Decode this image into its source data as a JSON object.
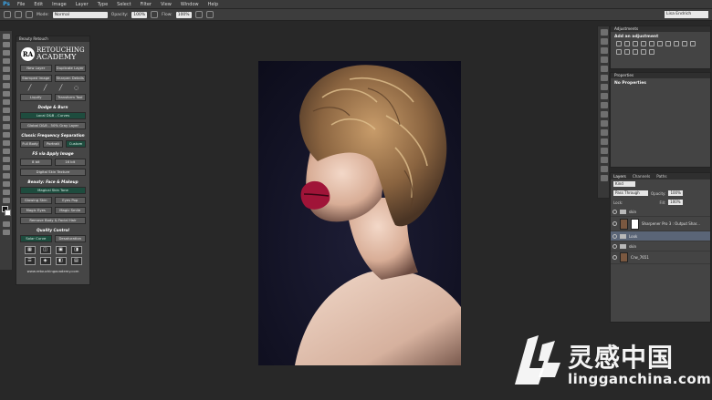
{
  "app": {
    "logo": "Ps"
  },
  "menu": [
    "File",
    "Edit",
    "Image",
    "Layer",
    "Type",
    "Select",
    "Filter",
    "View",
    "Window",
    "Help"
  ],
  "options_bar": {
    "mode_label": "Mode:",
    "mode_value": "Normal",
    "opacity_label": "Opacity:",
    "opacity_value": "100%",
    "flow_label": "Flow:",
    "flow_value": "100%",
    "workspace": "Lisa Endrich"
  },
  "beauty_panel": {
    "title": "Beauty Retouch",
    "logo_badge": "RA",
    "logo_line1": "RETOUCHING",
    "logo_line2": "ACADEMY",
    "row1": [
      "New Layer",
      "Duplicate Layer"
    ],
    "row2": [
      "Stamped Image",
      "Sharpen Details"
    ],
    "row3": [
      "Liquify",
      "Transform Tool"
    ],
    "sec_dodge": "Dodge & Burn",
    "btn_local_dnb": "Local D&B - Curves",
    "btn_global_dnb": "Global D&B - 50% Gray Layer",
    "sec_freq": "Classic Frequency Separation",
    "freq_btns": [
      "Full Body",
      "Portrait",
      "Custom"
    ],
    "sec_apply": "FS via Apply Image",
    "apply_btns": [
      "8 bit",
      "16 bit"
    ],
    "btn_digital": "Digital Skin Texture",
    "sec_face": "Beauty: Face & Makeup",
    "btn_magical": "Magical Skin Tone",
    "face_row1": [
      "Glowing Skin",
      "Eyes Pop"
    ],
    "face_row2": [
      "Magic Eyes",
      "Magic Smile"
    ],
    "btn_remove": "Remove Body & Facial Hair",
    "sec_quality": "Quality Control",
    "quality_btns": [
      "Solar Curve",
      "Desaturation"
    ],
    "url": "www.retouchingacademy.com"
  },
  "adjustments": {
    "tab": "Adjustments",
    "title": "Add an adjustment"
  },
  "properties": {
    "tab": "Properties",
    "title": "No Properties"
  },
  "layers": {
    "tabs": [
      "Layers",
      "Channels",
      "Paths"
    ],
    "filter_kind": "Kind",
    "blend_mode": "Pass Through",
    "opacity_label": "Opacity:",
    "opacity_value": "100%",
    "lock_label": "Lock:",
    "fill_label": "Fill:",
    "fill_value": "100%",
    "items": [
      "skin",
      "Sharpener Pro 3 : Output Shar...",
      "Look",
      "skin",
      "Crw_7651"
    ]
  },
  "watermark": {
    "cn": "灵感中国",
    "en": "lingganchina.com"
  },
  "colors": {
    "accent_green": "#1e4c3e",
    "ps_blue": "#3aa5e8",
    "panel_bg": "#464646",
    "lip": "#a01438"
  }
}
